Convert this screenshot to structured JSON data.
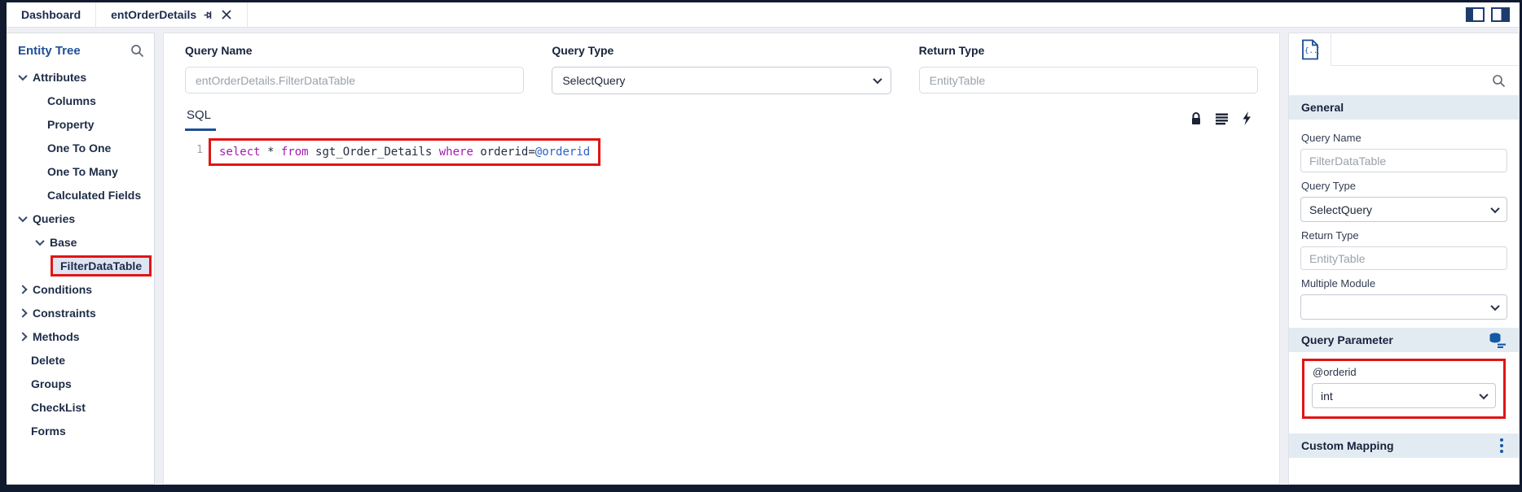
{
  "colors": {
    "accent_blue": "#1d4f96",
    "navy_text": "#1c2b4d",
    "annotation_red": "#e11515",
    "sql_keyword": "#a21caf",
    "sql_plain": "#252e40",
    "sql_variable": "#2b62c4",
    "section_header_bg": "#e3ebf2",
    "selected_item_bg": "#dfe4f3"
  },
  "tab_bar": {
    "tabs": [
      {
        "label": "Dashboard",
        "active": false
      },
      {
        "label": "entOrderDetails",
        "active": true,
        "icons": [
          "pin-icon",
          "close-icon"
        ]
      }
    ],
    "window_icons": [
      "panel-left-icon",
      "panel-right-icon"
    ]
  },
  "entity_tree": {
    "title": "Entity Tree",
    "items": [
      {
        "label": "Attributes",
        "level": 0,
        "state": "expanded"
      },
      {
        "label": "Columns",
        "level": 1
      },
      {
        "label": "Property",
        "level": 1
      },
      {
        "label": "One To One",
        "level": 1
      },
      {
        "label": "One To Many",
        "level": 1
      },
      {
        "label": "Calculated Fields",
        "level": 1
      },
      {
        "label": "Queries",
        "level": 0,
        "state": "expanded"
      },
      {
        "label": "Base",
        "level": 1,
        "state": "expanded"
      },
      {
        "label": "FilterDataTable",
        "level": 2,
        "selected": true,
        "annotated": true
      },
      {
        "label": "Conditions",
        "level": 0,
        "state": "collapsed"
      },
      {
        "label": "Constraints",
        "level": 0,
        "state": "collapsed"
      },
      {
        "label": "Methods",
        "level": 0,
        "state": "collapsed"
      },
      {
        "label": "Delete",
        "level": 0
      },
      {
        "label": "Groups",
        "level": 0
      },
      {
        "label": "CheckList",
        "level": 0
      },
      {
        "label": "Forms",
        "level": 0
      }
    ]
  },
  "query_form": {
    "query_name": {
      "label": "Query Name",
      "value": "entOrderDetails.FilterDataTable"
    },
    "query_type": {
      "label": "Query Type",
      "value": "SelectQuery"
    },
    "return_type": {
      "label": "Return Type",
      "value": "EntityTable"
    }
  },
  "sql_editor": {
    "tab_label": "SQL",
    "line_number": "1",
    "code": "select * from sgt_Order_Details where orderid=@orderid",
    "tokens": [
      {
        "text": "select ",
        "type": "keyword"
      },
      {
        "text": "* ",
        "type": "plain"
      },
      {
        "text": "from ",
        "type": "keyword"
      },
      {
        "text": "sgt_Order_Details ",
        "type": "plain"
      },
      {
        "text": "where ",
        "type": "keyword"
      },
      {
        "text": "orderid=",
        "type": "plain"
      },
      {
        "text": "@orderid",
        "type": "variable"
      }
    ],
    "toolbar_icons": [
      "lock-icon",
      "format-lines-icon",
      "lightning-icon"
    ]
  },
  "inspector": {
    "general_title": "General",
    "query_name": {
      "label": "Query Name",
      "value": "FilterDataTable"
    },
    "query_type": {
      "label": "Query Type",
      "value": "SelectQuery"
    },
    "return_type": {
      "label": "Return Type",
      "value": "EntityTable"
    },
    "multiple_module": {
      "label": "Multiple Module",
      "value": ""
    },
    "query_parameter_title": "Query Parameter",
    "parameter": {
      "name": "@orderid",
      "type": "int"
    },
    "custom_mapping_title": "Custom Mapping"
  }
}
